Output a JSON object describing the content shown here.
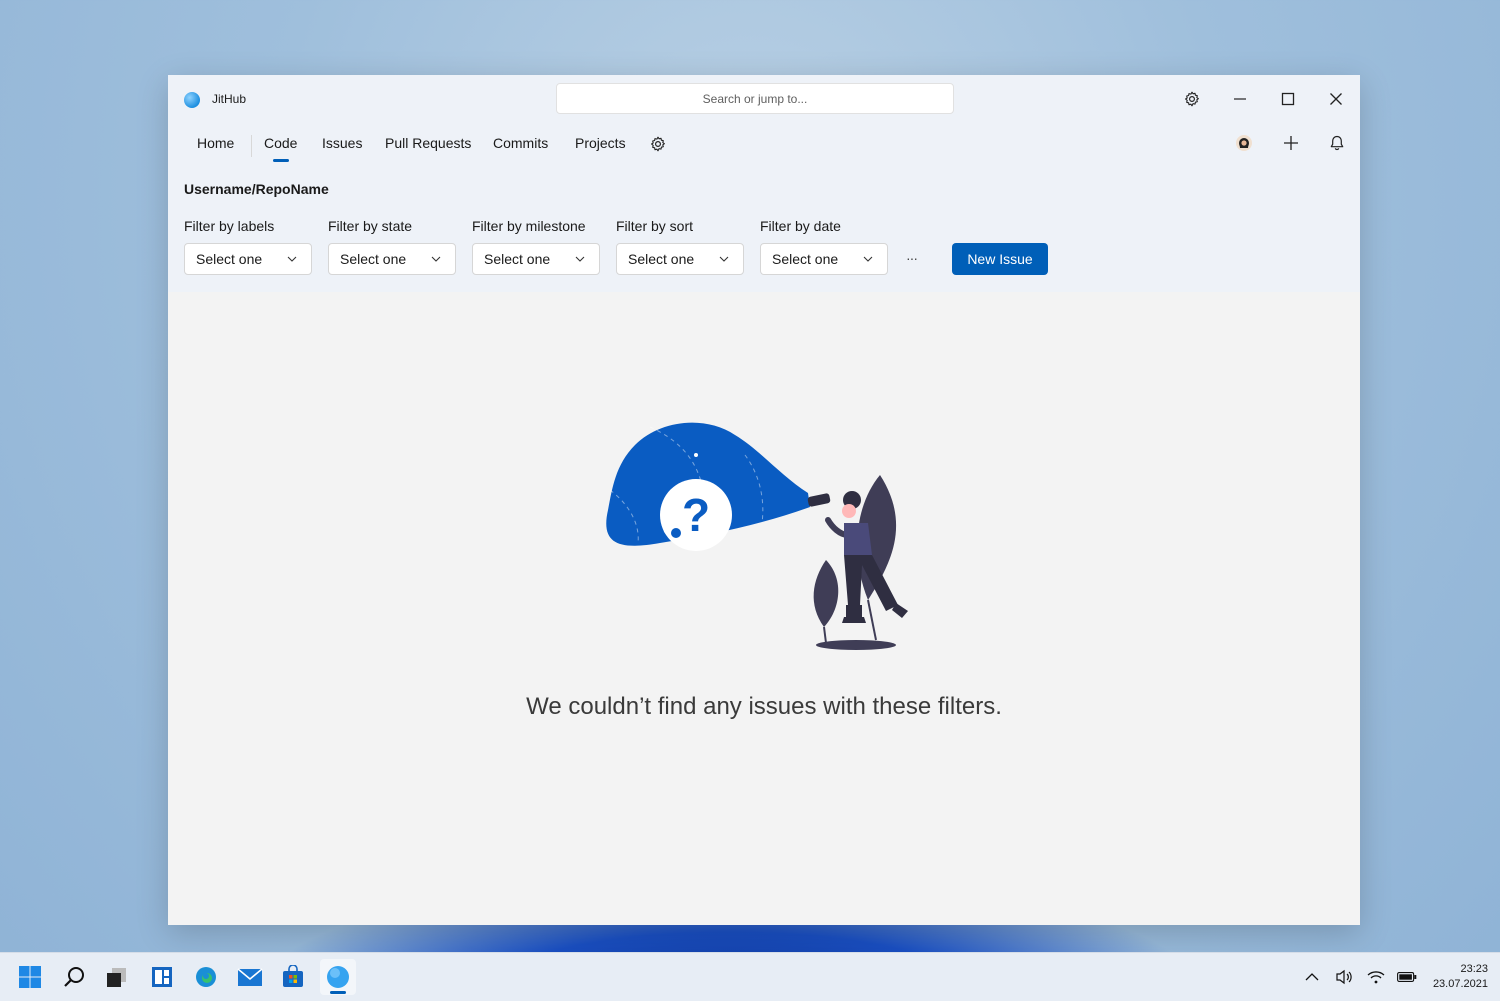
{
  "window": {
    "app_title": "JitHub",
    "search_placeholder": "Search or jump to..."
  },
  "nav": {
    "items": [
      {
        "label": "Home"
      },
      {
        "label": "Code",
        "active": true
      },
      {
        "label": "Issues"
      },
      {
        "label": "Pull Requests"
      },
      {
        "label": "Commits"
      },
      {
        "label": "Projects"
      }
    ]
  },
  "repo": "Username/RepoName",
  "filters": [
    {
      "label": "Filter by labels",
      "value": "Select one"
    },
    {
      "label": "Filter by state",
      "value": "Select one"
    },
    {
      "label": "Filter by milestone",
      "value": "Select one"
    },
    {
      "label": "Filter by sort",
      "value": "Select one"
    },
    {
      "label": "Filter by date",
      "value": "Select one"
    }
  ],
  "more_label": "···",
  "new_issue_label": "New Issue",
  "empty_message": "We couldn’t find any issues with these filters.",
  "taskbar": {
    "time": "23:23",
    "date": "23.07.2021",
    "icons": [
      "windows-start-icon",
      "search-icon",
      "task-view-icon",
      "widgets-icon",
      "edge-icon",
      "mail-icon",
      "store-icon",
      "jithub-icon"
    ]
  },
  "colors": {
    "accent": "#005fb8",
    "illustration_blue": "#0a5cc2",
    "illustration_dark": "#3f3d56"
  }
}
